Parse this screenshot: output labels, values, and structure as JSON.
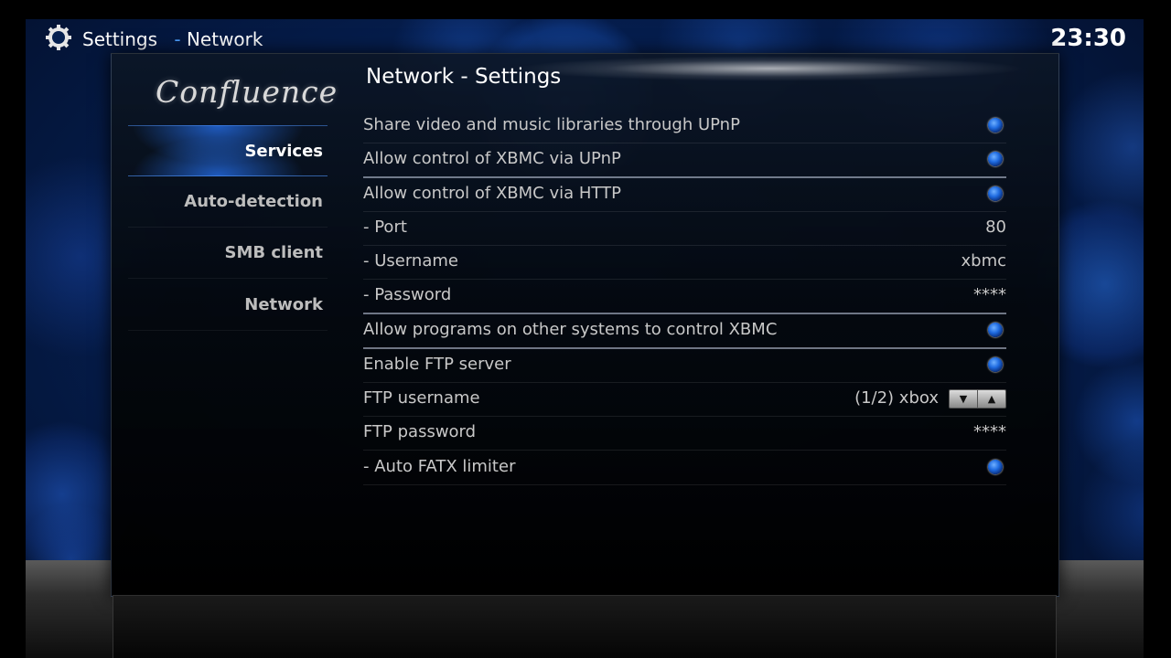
{
  "header": {
    "breadcrumb_root": "Settings",
    "breadcrumb_separator": "-",
    "breadcrumb_current": "Network",
    "clock": "23:30"
  },
  "logo_text": "Confluence",
  "sidebar": {
    "items": [
      {
        "label": "Services",
        "active": true
      },
      {
        "label": "Auto-detection",
        "active": false
      },
      {
        "label": "SMB client",
        "active": false
      },
      {
        "label": "Network",
        "active": false
      }
    ]
  },
  "content": {
    "title": "Network - Settings",
    "settings": [
      {
        "label": "Share video and music libraries through UPnP",
        "type": "toggle",
        "enabled": true
      },
      {
        "label": "Allow control of XBMC via UPnP",
        "type": "toggle",
        "enabled": true
      },
      {
        "label": "Allow control of XBMC via HTTP",
        "type": "toggle",
        "enabled": true
      },
      {
        "label": "- Port",
        "type": "value",
        "value": "80"
      },
      {
        "label": "- Username",
        "type": "value",
        "value": "xbmc"
      },
      {
        "label": "- Password",
        "type": "value",
        "value": "****"
      },
      {
        "label": "Allow programs on other systems to control XBMC",
        "type": "toggle",
        "enabled": true
      },
      {
        "label": "Enable FTP server",
        "type": "toggle",
        "enabled": true
      },
      {
        "label": "FTP username",
        "type": "spinner",
        "value": "(1/2) xbox"
      },
      {
        "label": "FTP password",
        "type": "value",
        "value": "****"
      },
      {
        "label": "- Auto FATX limiter",
        "type": "toggle",
        "enabled": true
      }
    ]
  },
  "icons": {
    "header": "gear-icon",
    "toggle": "radio-on-icon",
    "spinner_down": "arrow-down-icon",
    "spinner_up": "arrow-up-icon"
  },
  "colors": {
    "accent": "#4da0ff",
    "background": "#051c4a",
    "text": "#c8c8c8"
  }
}
